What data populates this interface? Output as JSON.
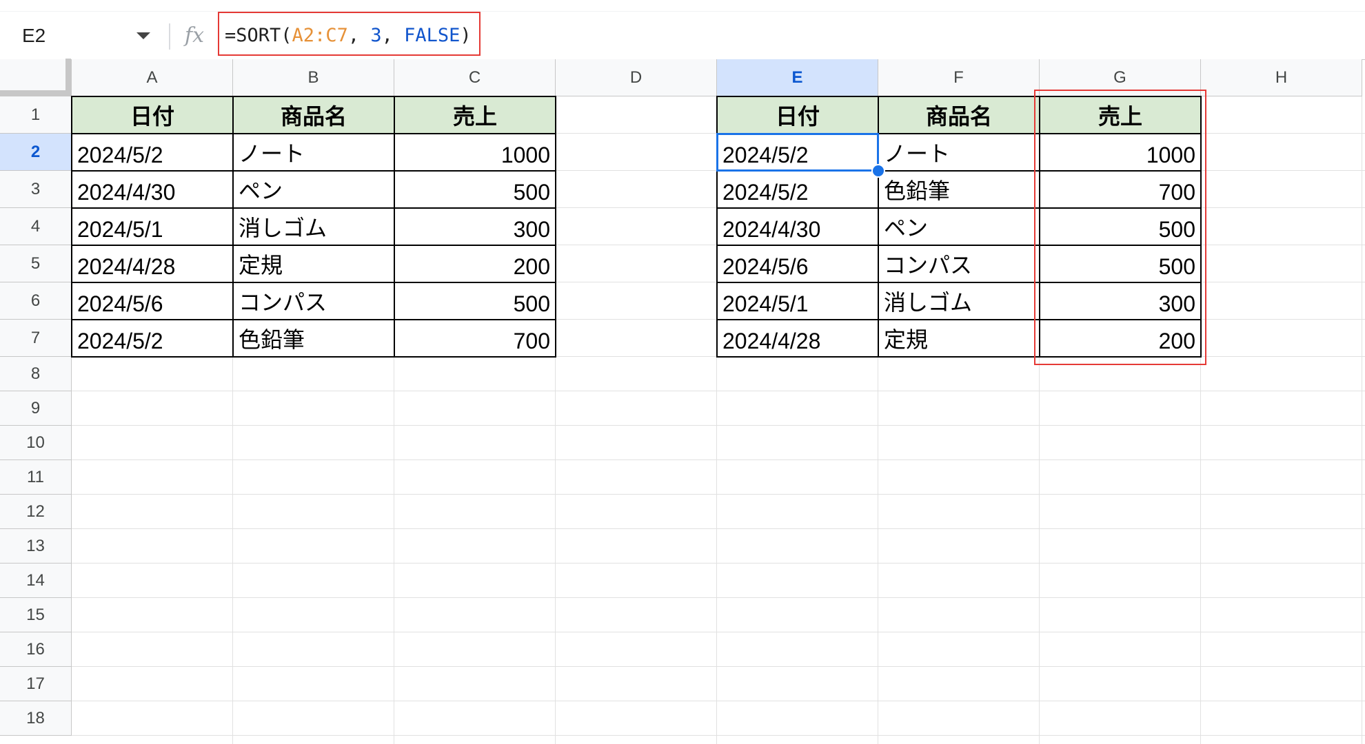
{
  "name_box": "E2",
  "fx_label": "fx",
  "formula": {
    "prefix": "=SORT(",
    "range": "A2:C7",
    "sep1": ", ",
    "col": "3",
    "sep2": ", ",
    "bool": "FALSE",
    "suffix": ")"
  },
  "formula_colors": {
    "range": "#e69138",
    "number": "#1155cc",
    "bool": "#1155cc",
    "text": "#1f1f1f"
  },
  "columns": [
    "A",
    "B",
    "C",
    "D",
    "E",
    "F",
    "G",
    "H"
  ],
  "active_column": "E",
  "rows": [
    "1",
    "2",
    "3",
    "4",
    "5",
    "6",
    "7",
    "8",
    "9",
    "10",
    "11",
    "12",
    "13",
    "14",
    "15",
    "16",
    "17",
    "18"
  ],
  "active_row": "2",
  "source_table": {
    "headers": [
      "日付",
      "商品名",
      "売上"
    ],
    "rows": [
      [
        "2024/5/2",
        "ノート",
        "1000"
      ],
      [
        "2024/4/30",
        "ペン",
        "500"
      ],
      [
        "2024/5/1",
        "消しゴム",
        "300"
      ],
      [
        "2024/4/28",
        "定規",
        "200"
      ],
      [
        "2024/5/6",
        "コンパス",
        "500"
      ],
      [
        "2024/5/2",
        "色鉛筆",
        "700"
      ]
    ]
  },
  "result_table": {
    "headers": [
      "日付",
      "商品名",
      "売上"
    ],
    "rows": [
      [
        "2024/5/2",
        "ノート",
        "1000"
      ],
      [
        "2024/5/2",
        "色鉛筆",
        "700"
      ],
      [
        "2024/4/30",
        "ペン",
        "500"
      ],
      [
        "2024/5/6",
        "コンパス",
        "500"
      ],
      [
        "2024/5/1",
        "消しゴム",
        "300"
      ],
      [
        "2024/4/28",
        "定規",
        "200"
      ]
    ]
  },
  "colors": {
    "header_fill": "#d9ead3",
    "selection": "#1a73e8",
    "highlight": "#e53935"
  }
}
